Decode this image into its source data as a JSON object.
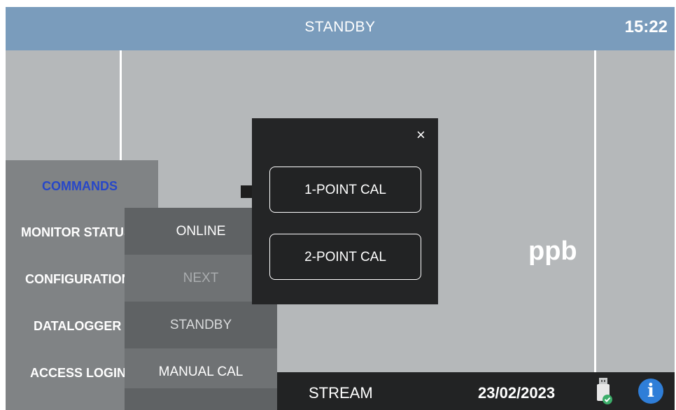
{
  "topbar": {
    "status": "STANDBY",
    "clock": "15:22"
  },
  "main": {
    "unit": "ppb"
  },
  "menu": {
    "items": [
      {
        "label": "COMMANDS",
        "active": true
      },
      {
        "label": "MONITOR STATUS"
      },
      {
        "label": "CONFIGURATION"
      },
      {
        "label": "DATALOGGER"
      },
      {
        "label": "ACCESS LOGIN"
      }
    ]
  },
  "submenu": {
    "items": [
      {
        "label": "ONLINE"
      },
      {
        "label": "NEXT",
        "disabled": true
      },
      {
        "label": "STANDBY"
      },
      {
        "label": "MANUAL CAL"
      }
    ]
  },
  "dialog": {
    "close_icon": "×",
    "buttons": [
      {
        "label": "1-POINT CAL"
      },
      {
        "label": "2-POINT CAL"
      }
    ]
  },
  "statusbar": {
    "stream": "STREAM",
    "date": "23/02/2023",
    "usb_icon": "usb-drive-ok-icon",
    "info_icon": "i"
  },
  "colors": {
    "topbar": "#7a9cbc",
    "background": "#b5b8ba",
    "menu": "#808385",
    "active_menu_text": "#2747c8",
    "dialog": "#242526",
    "info": "#2f7ed8"
  }
}
